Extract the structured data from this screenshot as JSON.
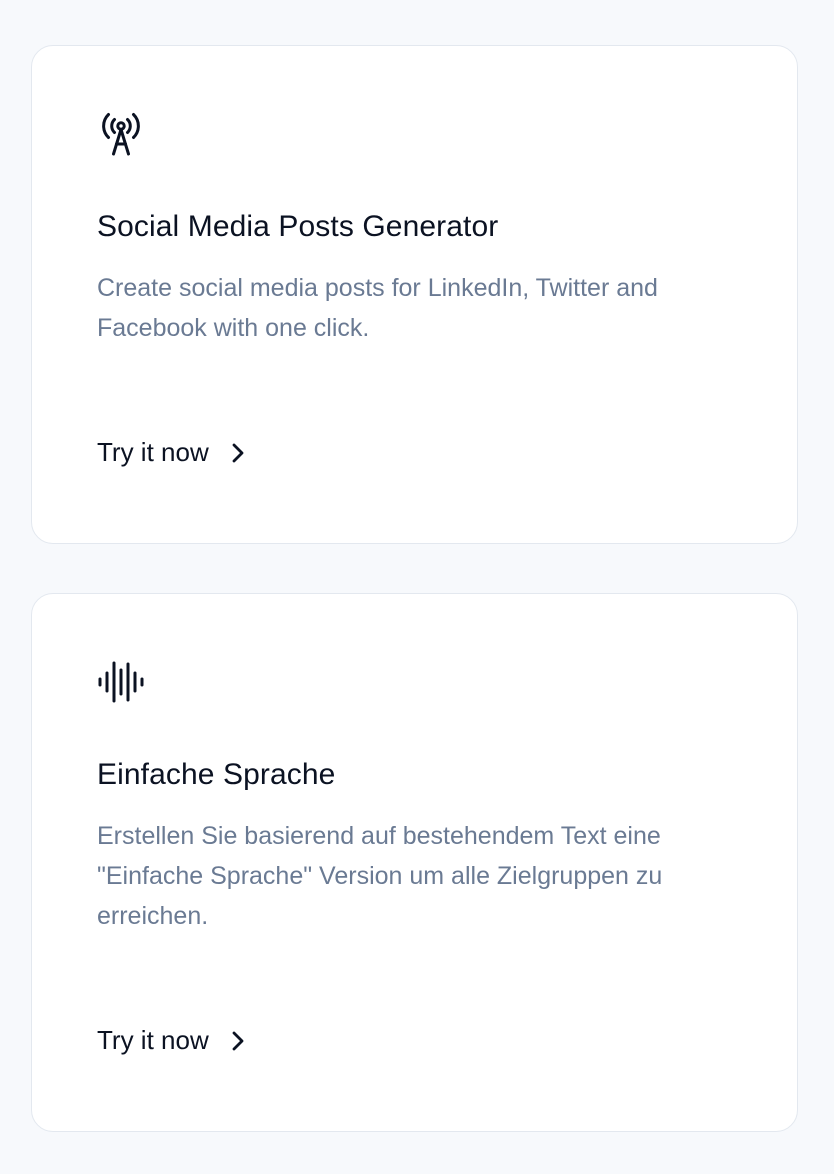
{
  "cards": [
    {
      "icon": "broadcast-tower-icon",
      "title": "Social Media Posts Generator",
      "description": "Create social media posts for LinkedIn, Twitter and Facebook with one click.",
      "cta_label": "Try it now"
    },
    {
      "icon": "audio-waveform-icon",
      "title": "Einfache Sprache",
      "description": "Erstellen Sie basierend auf bestehendem Text eine \"Einfache Sprache\" Version um alle Zielgruppen zu erreichen.",
      "cta_label": "Try it now"
    }
  ],
  "colors": {
    "page_bg": "#f7f9fc",
    "card_bg": "#ffffff",
    "card_border": "#e3e8ef",
    "title": "#0b1222",
    "description": "#6a7a93"
  }
}
